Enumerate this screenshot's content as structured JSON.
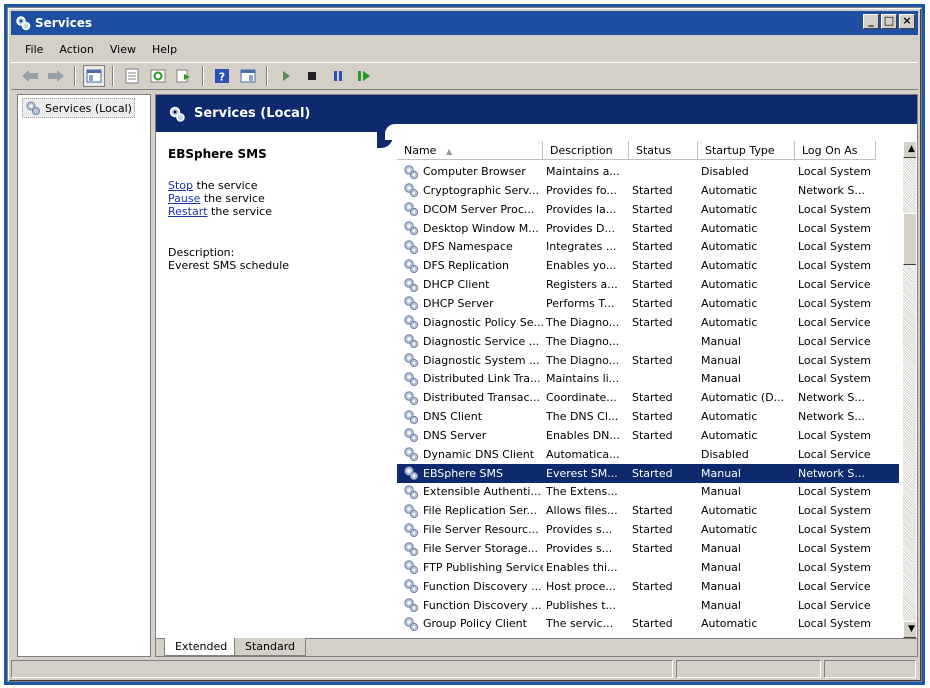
{
  "window": {
    "title": "Services"
  },
  "title_buttons": {
    "minimize": "_",
    "maximize": "□",
    "close": "×"
  },
  "menu": [
    "File",
    "Action",
    "View",
    "Help"
  ],
  "tree": {
    "root_label": "Services (Local)"
  },
  "header": {
    "title": "Services (Local)"
  },
  "detail": {
    "service_name": "EBSphere SMS",
    "stop_link": "Stop",
    "stop_rest": " the service",
    "pause_link": "Pause",
    "pause_rest": " the service",
    "restart_link": "Restart",
    "restart_rest": " the service",
    "description_label": "Description:",
    "description_text": "Everest SMS schedule"
  },
  "columns": {
    "name": "Name",
    "sort_indicator": "▲",
    "description": "Description",
    "status": "Status",
    "startup_type": "Startup Type",
    "log_on_as": "Log On As"
  },
  "rows": [
    {
      "name": "Computer Browser",
      "description": "Maintains a...",
      "status": "",
      "startup": "Disabled",
      "logon": "Local System"
    },
    {
      "name": "Cryptographic Serv...",
      "description": "Provides fo...",
      "status": "Started",
      "startup": "Automatic",
      "logon": "Network S..."
    },
    {
      "name": "DCOM Server Proc...",
      "description": "Provides la...",
      "status": "Started",
      "startup": "Automatic",
      "logon": "Local System"
    },
    {
      "name": "Desktop Window M...",
      "description": "Provides D...",
      "status": "Started",
      "startup": "Automatic",
      "logon": "Local System"
    },
    {
      "name": "DFS Namespace",
      "description": "Integrates ...",
      "status": "Started",
      "startup": "Automatic",
      "logon": "Local System"
    },
    {
      "name": "DFS Replication",
      "description": "Enables yo...",
      "status": "Started",
      "startup": "Automatic",
      "logon": "Local System"
    },
    {
      "name": "DHCP Client",
      "description": "Registers a...",
      "status": "Started",
      "startup": "Automatic",
      "logon": "Local Service"
    },
    {
      "name": "DHCP Server",
      "description": "Performs T...",
      "status": "Started",
      "startup": "Automatic",
      "logon": "Local System"
    },
    {
      "name": "Diagnostic Policy Se...",
      "description": "The Diagno...",
      "status": "Started",
      "startup": "Automatic",
      "logon": "Local Service"
    },
    {
      "name": "Diagnostic Service ...",
      "description": "The Diagno...",
      "status": "",
      "startup": "Manual",
      "logon": "Local Service"
    },
    {
      "name": "Diagnostic System ...",
      "description": "The Diagno...",
      "status": "Started",
      "startup": "Manual",
      "logon": "Local System"
    },
    {
      "name": "Distributed Link Tra...",
      "description": "Maintains li...",
      "status": "",
      "startup": "Manual",
      "logon": "Local System"
    },
    {
      "name": "Distributed Transac...",
      "description": "Coordinate...",
      "status": "Started",
      "startup": "Automatic (D...",
      "logon": "Network S..."
    },
    {
      "name": "DNS Client",
      "description": "The DNS Cl...",
      "status": "Started",
      "startup": "Automatic",
      "logon": "Network S..."
    },
    {
      "name": "DNS Server",
      "description": "Enables DN...",
      "status": "Started",
      "startup": "Automatic",
      "logon": "Local System"
    },
    {
      "name": "Dynamic DNS Client",
      "description": "Automatica...",
      "status": "",
      "startup": "Disabled",
      "logon": "Local Service"
    },
    {
      "name": "EBSphere SMS",
      "description": "Everest SM...",
      "status": "Started",
      "startup": "Manual",
      "logon": "Network S...",
      "selected": true
    },
    {
      "name": "Extensible Authenti...",
      "description": "The Extens...",
      "status": "",
      "startup": "Manual",
      "logon": "Local System"
    },
    {
      "name": "File Replication Ser...",
      "description": "Allows files...",
      "status": "Started",
      "startup": "Automatic",
      "logon": "Local System"
    },
    {
      "name": "File Server Resourc...",
      "description": "Provides s...",
      "status": "Started",
      "startup": "Automatic",
      "logon": "Local System"
    },
    {
      "name": "File Server Storage...",
      "description": "Provides s...",
      "status": "Started",
      "startup": "Manual",
      "logon": "Local System"
    },
    {
      "name": "FTP Publishing Service",
      "description": "Enables thi...",
      "status": "",
      "startup": "Manual",
      "logon": "Local System"
    },
    {
      "name": "Function Discovery ...",
      "description": "Host proce...",
      "status": "Started",
      "startup": "Manual",
      "logon": "Local Service"
    },
    {
      "name": "Function Discovery ...",
      "description": "Publishes t...",
      "status": "",
      "startup": "Manual",
      "logon": "Local Service"
    },
    {
      "name": "Group Policy Client",
      "description": "The servic...",
      "status": "Started",
      "startup": "Automatic",
      "logon": "Local System"
    }
  ],
  "tabs": {
    "extended": "Extended",
    "standard": "Standard"
  },
  "colors": {
    "title_blue": "#1e4fa0",
    "header_navy": "#0e2a6e",
    "link_blue": "#1a35a8",
    "face": "#d4d0c8"
  }
}
